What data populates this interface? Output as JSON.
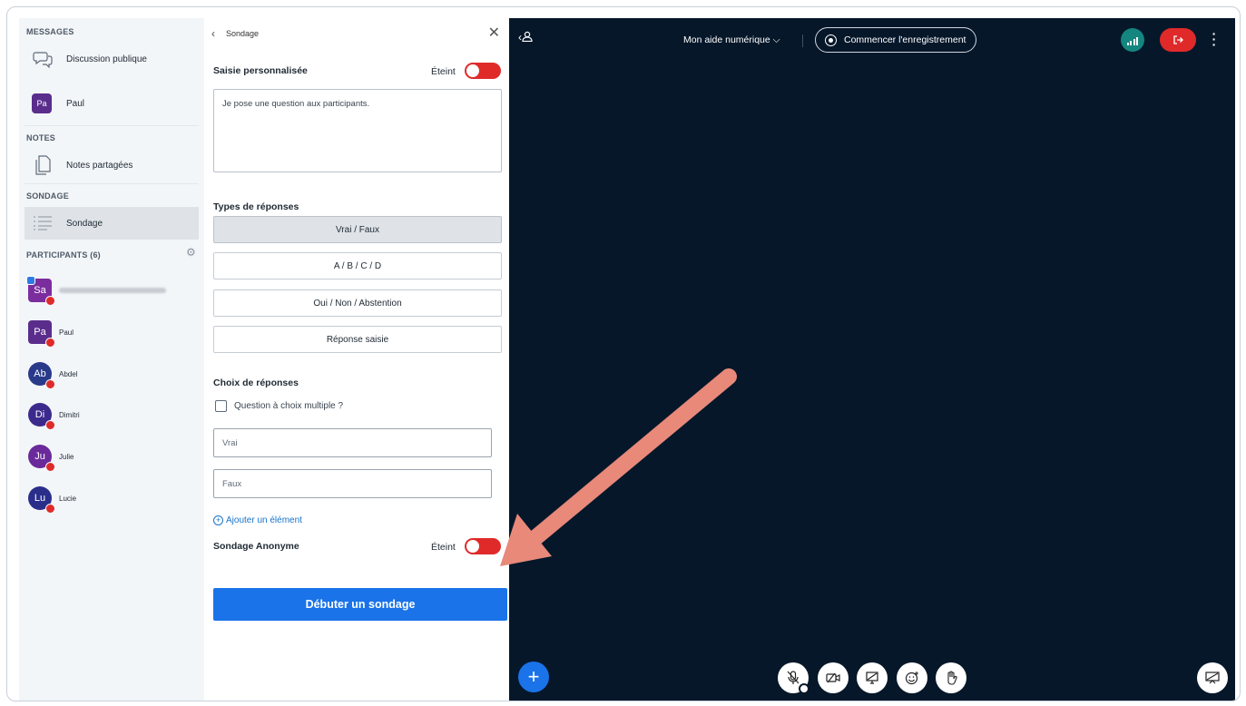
{
  "sidebar": {
    "messages_title": "MESSAGES",
    "public_chat": "Discussion publique",
    "private_chat_initials": "Pa",
    "private_chat_name": "Paul",
    "notes_title": "NOTES",
    "shared_notes": "Notes partagées",
    "poll_title": "SONDAGE",
    "poll_item": "Sondage",
    "participants_title": "PARTICIPANTS (6)",
    "participants": [
      {
        "initials": "Sa",
        "name": ""
      },
      {
        "initials": "Pa",
        "name": "Paul"
      },
      {
        "initials": "Ab",
        "name": "Abdel"
      },
      {
        "initials": "Di",
        "name": "Dimitri"
      },
      {
        "initials": "Ju",
        "name": "Julie"
      },
      {
        "initials": "Lu",
        "name": "Lucie"
      }
    ]
  },
  "poll": {
    "header_title": "Sondage",
    "custom_input_label": "Saisie personnalisée",
    "custom_input_state": "Éteint",
    "question_text": "Je pose une question aux participants.",
    "response_types_label": "Types de réponses",
    "response_types": [
      "Vrai / Faux",
      "A / B / C / D",
      "Oui / Non / Abstention",
      "Réponse saisie"
    ],
    "choices_label": "Choix de réponses",
    "multiple_choice_label": "Question à choix multiple ?",
    "choices": [
      "Vrai",
      "Faux"
    ],
    "add_item": "Ajouter un élément",
    "anonymous_label": "Sondage Anonyme",
    "anonymous_state": "Éteint",
    "start_button": "Débuter un sondage"
  },
  "presentation": {
    "meeting_title": "Mon aide numérique",
    "record_button": "Commencer l'enregistrement",
    "colors": {
      "background": "#06172a",
      "accent": "#1a73e8",
      "danger": "#e02a2a",
      "network": "#14857f"
    }
  }
}
